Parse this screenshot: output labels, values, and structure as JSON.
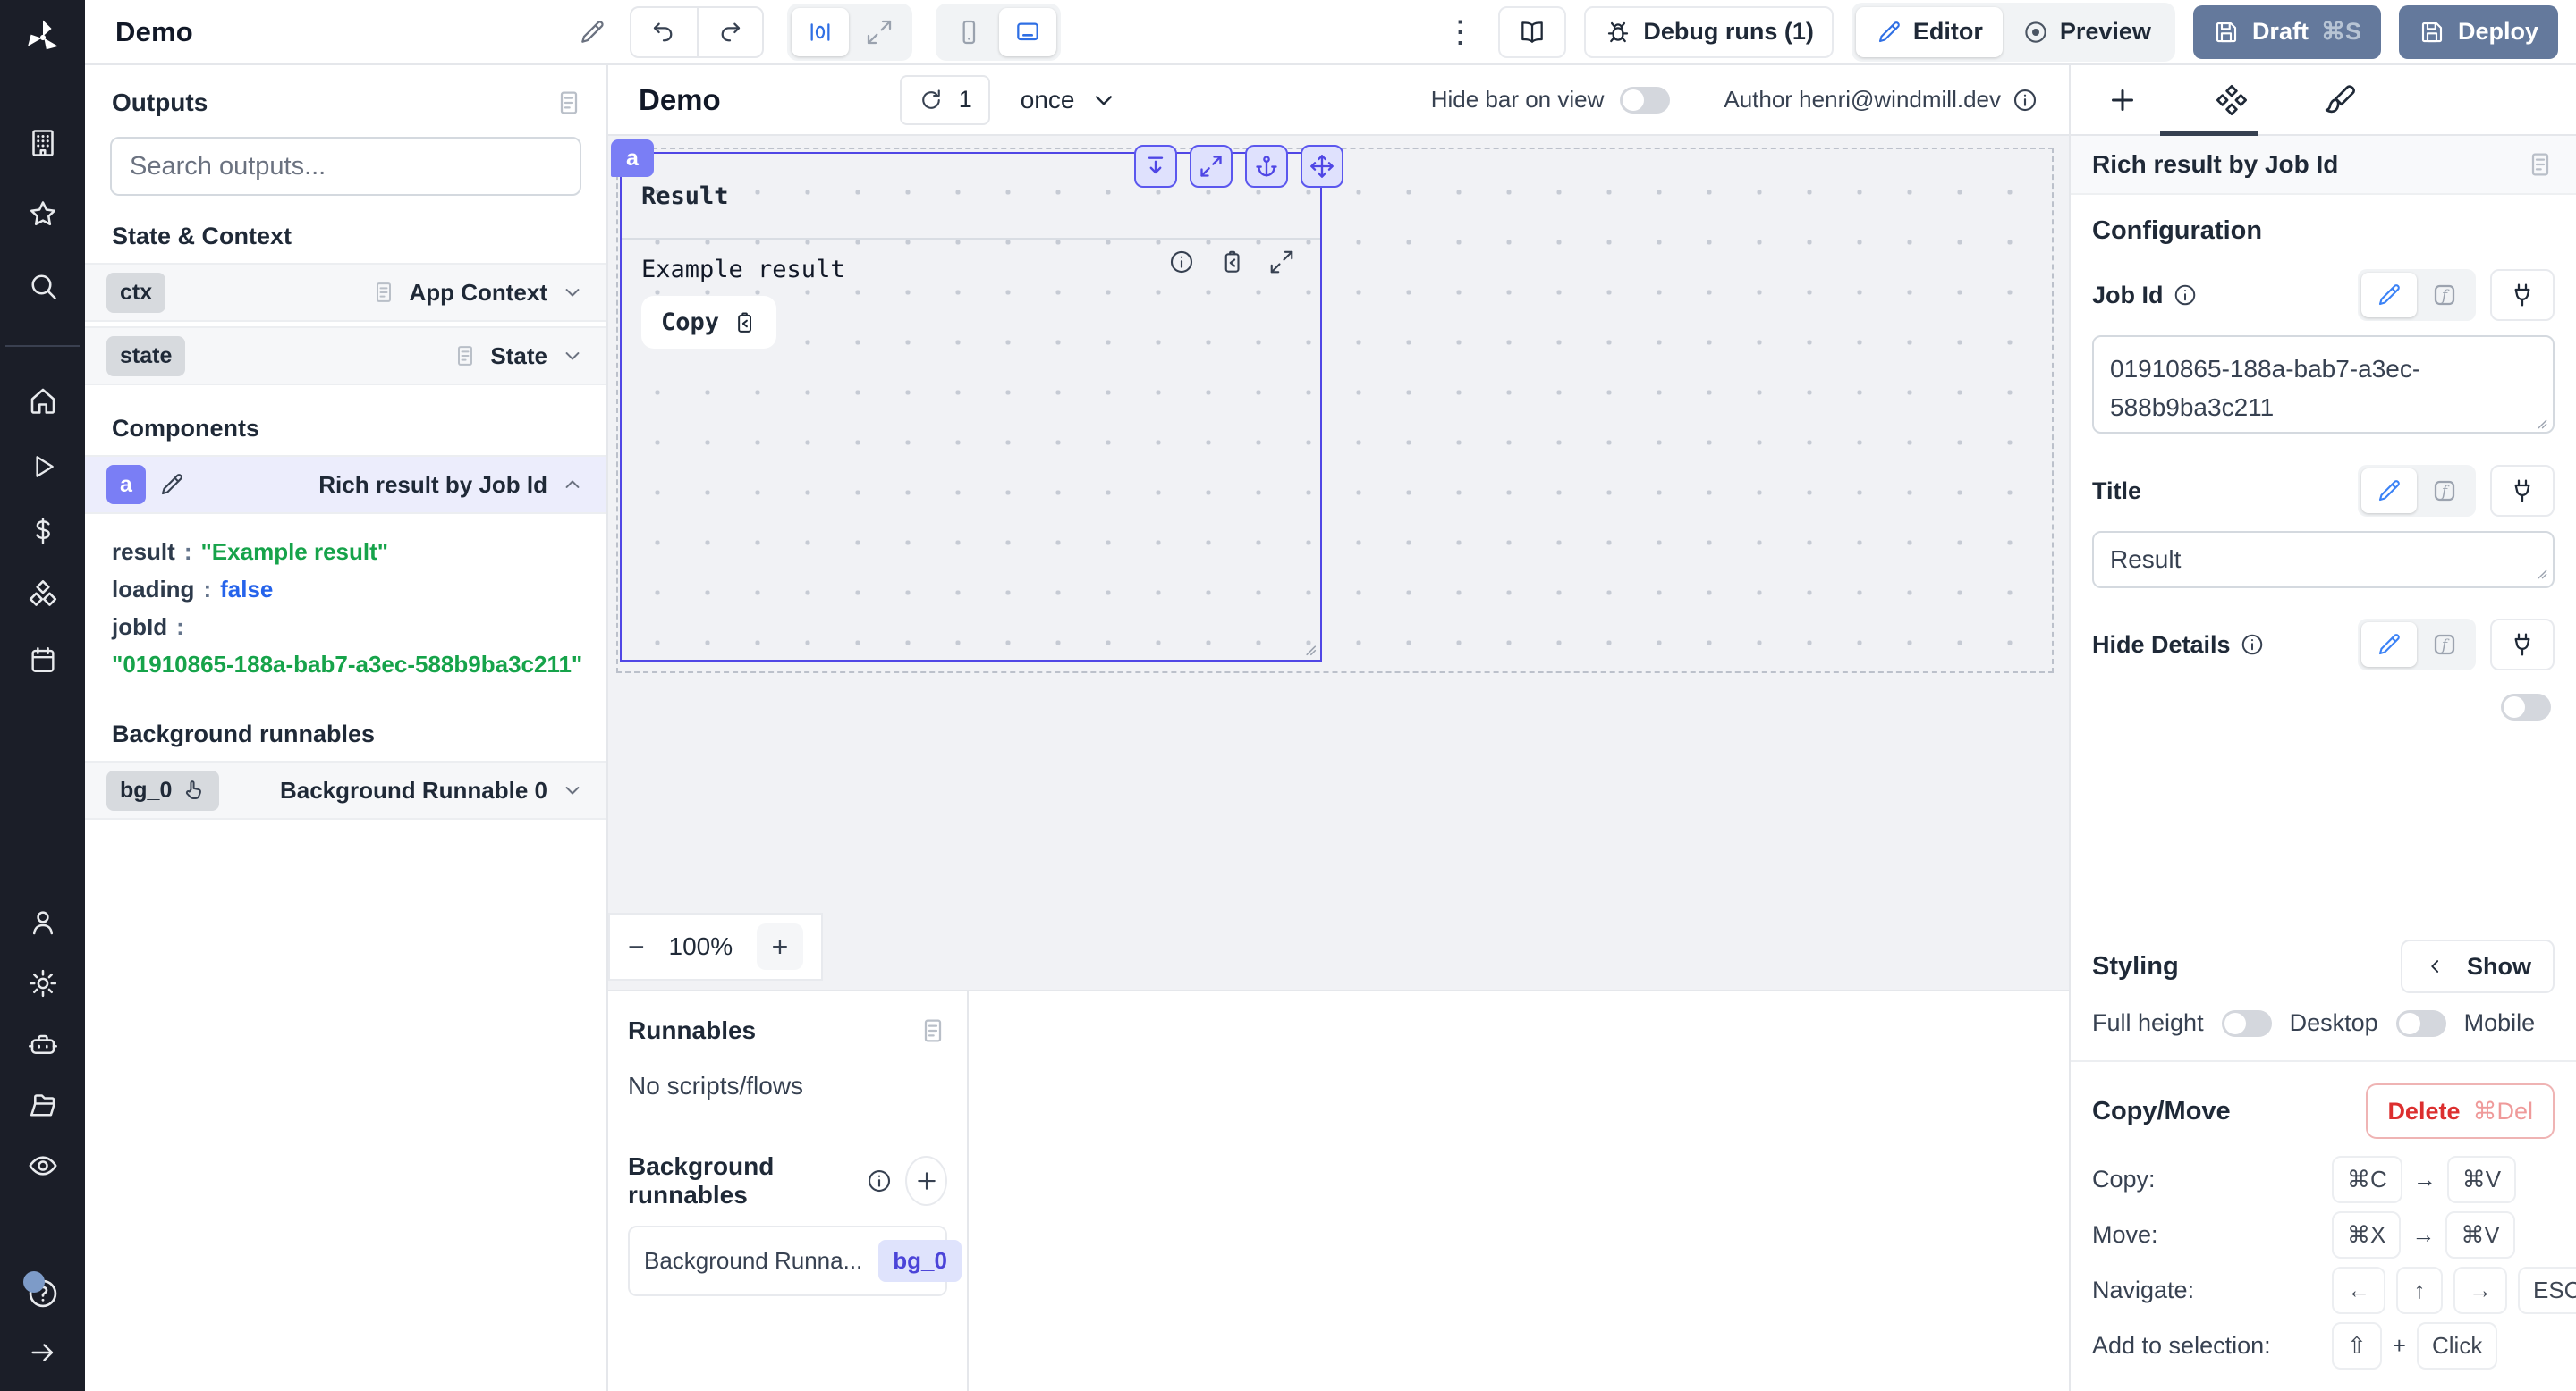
{
  "topbar": {
    "app_title": "Demo",
    "kebab": "⋮",
    "debug_runs_label": "Debug runs (1)",
    "editor_label": "Editor",
    "preview_label": "Preview",
    "draft_label": "Draft",
    "draft_shortcut": "⌘S",
    "deploy_label": "Deploy"
  },
  "outputs_panel": {
    "title": "Outputs",
    "search_placeholder": "Search outputs...",
    "state_context_title": "State & Context",
    "context_rows": [
      {
        "badge": "ctx",
        "label": "App Context"
      },
      {
        "badge": "state",
        "label": "State"
      }
    ],
    "components_title": "Components",
    "component_row": {
      "badge": "a",
      "label": "Rich result by Job Id"
    },
    "props": [
      {
        "key": "result",
        "sep": ":",
        "value": "\"Example result\""
      },
      {
        "key": "loading",
        "sep": ":",
        "value": "false"
      },
      {
        "key": "jobId",
        "sep": ":",
        "value": "\"01910865-188a-bab7-a3ec-588b9ba3c211\""
      }
    ],
    "background_title": "Background runnables",
    "background_row": {
      "badge": "bg_0",
      "label": "Background Runnable 0"
    }
  },
  "canvas": {
    "header": {
      "title": "Demo",
      "refresh_count": "1",
      "run_mode": "once",
      "hide_bar_label": "Hide bar on view",
      "author_label": "Author henri@windmill.dev"
    },
    "component": {
      "tag": "a",
      "title": "Result",
      "result_text": "Example result",
      "copy_label": "Copy"
    },
    "zoom_out": "−",
    "zoom_level": "100%",
    "zoom_in": "+"
  },
  "runnables_panel": {
    "title": "Runnables",
    "empty_text": "No scripts/flows",
    "background_title": "Background runnables",
    "item_label": "Background Runna...",
    "item_badge": "bg_0"
  },
  "settings_panel": {
    "header_title": "Rich result by Job Id",
    "configuration_title": "Configuration",
    "job_id_label": "Job Id",
    "job_id_value": "01910865-188a-bab7-a3ec-588b9ba3c211",
    "title_label": "Title",
    "title_value": "Result",
    "hide_details_label": "Hide Details",
    "styling_title": "Styling",
    "show_label": "Show",
    "full_height_label": "Full height",
    "desktop_label": "Desktop",
    "mobile_label": "Mobile",
    "copy_move_title": "Copy/Move",
    "delete_label": "Delete",
    "delete_shortcut": "⌘Del",
    "copy_row": {
      "label": "Copy:",
      "k1": "⌘C",
      "sep": "→",
      "k2": "⌘V"
    },
    "move_row": {
      "label": "Move:",
      "k1": "⌘X",
      "sep": "→",
      "k2": "⌘V"
    },
    "navigate_row": {
      "label": "Navigate:",
      "k1": "←",
      "k2": "↑",
      "k3": "→",
      "k4": "ESC"
    },
    "selection_row": {
      "label": "Add to selection:",
      "k1": "⇧",
      "sep": "+",
      "k2": "Click"
    }
  },
  "colors": {
    "accent_indigo": "#4f46e5",
    "string_green": "#16a34a",
    "boolean_blue": "#2563eb",
    "danger_red": "#dc2626",
    "deploy_slate": "#64799c"
  }
}
